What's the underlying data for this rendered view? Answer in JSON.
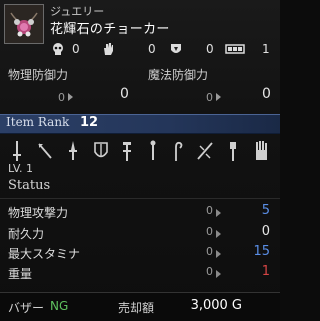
{
  "header": {
    "category": "ジュエリー",
    "item_name": "花輝石のチョーカー",
    "thumbnail_icon": "choker-icon"
  },
  "counters": [
    {
      "icon": "skull-icon",
      "value": "0"
    },
    {
      "icon": "hand-icon",
      "value": "0"
    },
    {
      "icon": "shield-emblem-icon",
      "value": "0"
    },
    {
      "icon": "bar-gauge-icon",
      "value": "1"
    }
  ],
  "defense": {
    "physical_label": "物理防御力",
    "magic_label": "魔法防御力",
    "physical_from": "0",
    "physical_to": "0",
    "magic_from": "0",
    "magic_to": "0"
  },
  "rank": {
    "label": "Item Rank",
    "value": "12"
  },
  "weapon_icons": [
    "sword-icon",
    "arrow-icon",
    "dagger-icon",
    "shield-icon",
    "staff-icon",
    "wand-icon",
    "crook-icon",
    "slash-icon",
    "mace-icon",
    "gauntlet-icon"
  ],
  "level": "LV. 1",
  "status": {
    "title": "Status",
    "rows": [
      {
        "label": "物理攻撃力",
        "from": "0",
        "to": "5",
        "color": "#5a8ee6"
      },
      {
        "label": "耐久力",
        "from": "0",
        "to": "0",
        "color": "#e6e6e6"
      },
      {
        "label": "最大スタミナ",
        "from": "0",
        "to": "15",
        "color": "#5a8ee6"
      },
      {
        "label": "重量",
        "from": "0",
        "to": "1",
        "color": "#d64545"
      }
    ]
  },
  "footer": {
    "bazaar_label": "バザー",
    "bazaar_value": "NG",
    "sell_label": "売却額",
    "sell_value": "3,000 G"
  }
}
